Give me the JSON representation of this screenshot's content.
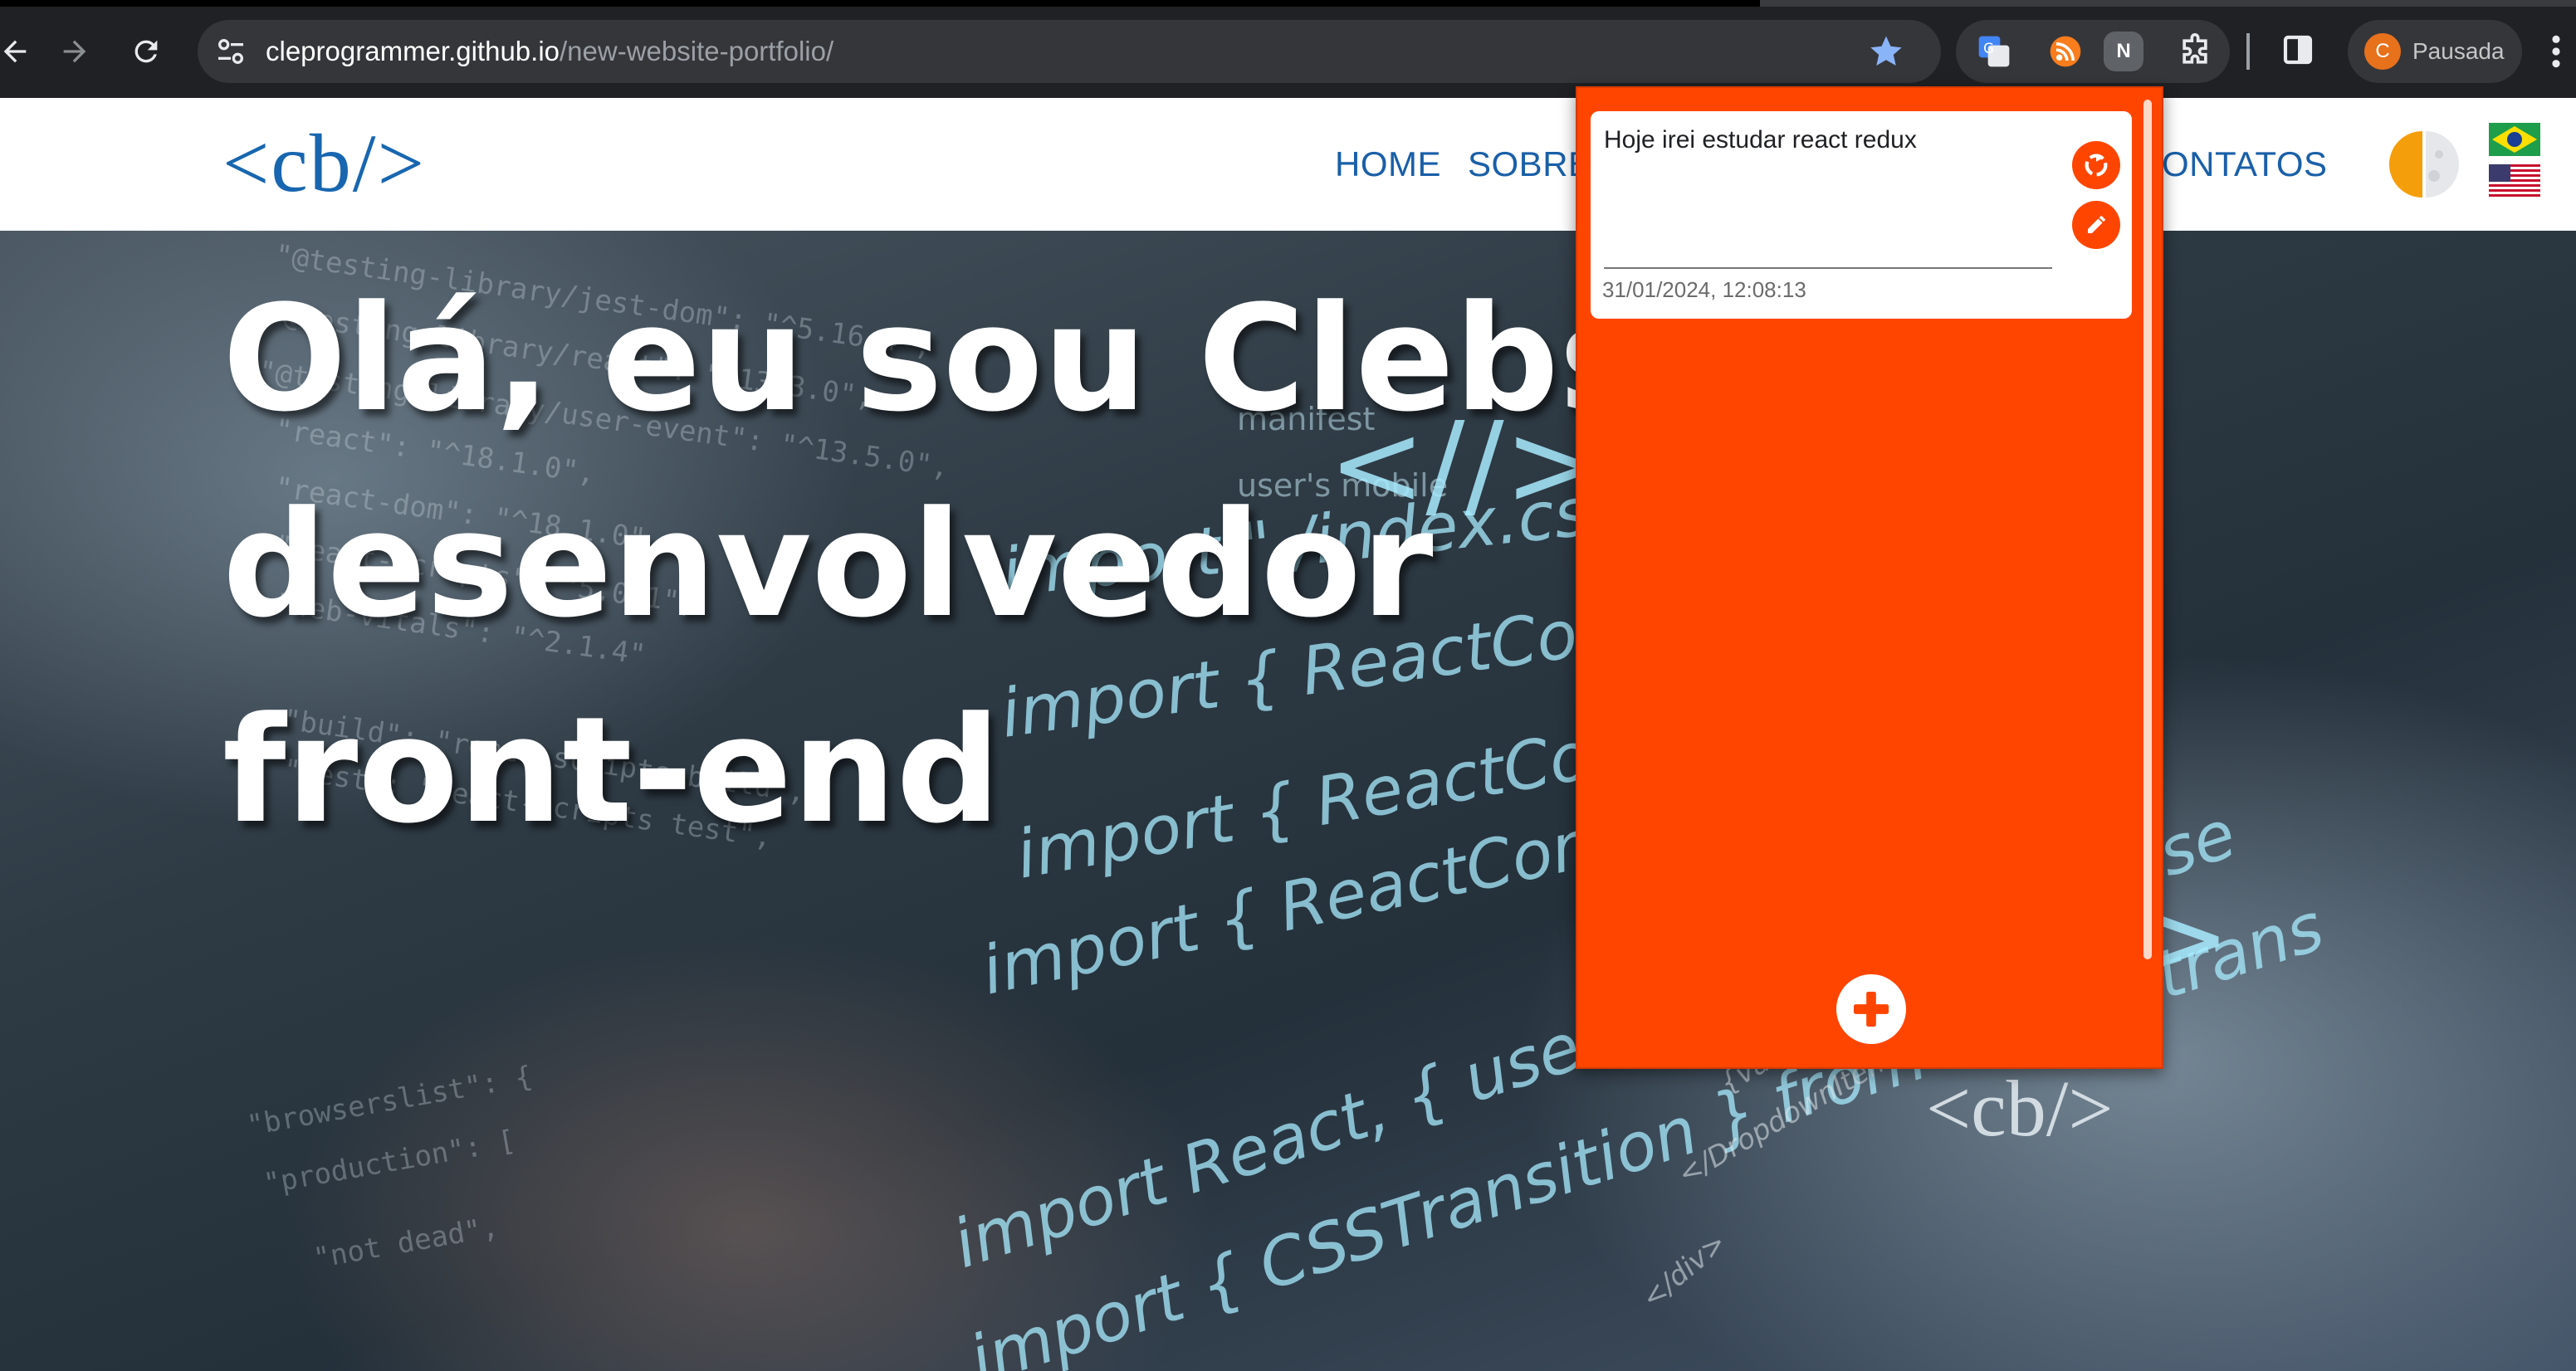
{
  "browser": {
    "url_host": "cleprogrammer.github.io",
    "url_path": "/new-website-portfolio/",
    "profile_initial": "C",
    "profile_status": "Pausada",
    "extension_letter": "N"
  },
  "site": {
    "logo": "<cb/>",
    "nav": {
      "home": "HOME",
      "sobre": "SOBRE",
      "contatos": "ONTATOS"
    },
    "hero": {
      "line1": "Olá, eu sou Clebso",
      "line2": "desenvolvedor",
      "line3": "front-end"
    }
  },
  "popup": {
    "note_text": "Hoje irei estudar react redux",
    "note_date": "31/01/2024, 12:08:13"
  },
  "colors": {
    "popup_bg": "#ff4500",
    "link_blue": "#1a5fa8",
    "chrome_bg": "#202124"
  },
  "icons": [
    "back-arrow-icon",
    "forward-arrow-icon",
    "reload-icon",
    "site-settings-icon",
    "star-icon",
    "translate-icon",
    "rss-icon",
    "puzzle-icon",
    "side-panel-icon",
    "kebab-menu-icon",
    "recycle-icon",
    "pencil-icon",
    "plus-icon",
    "moon-icon",
    "brazil-flag-icon",
    "usa-flag-icon"
  ]
}
